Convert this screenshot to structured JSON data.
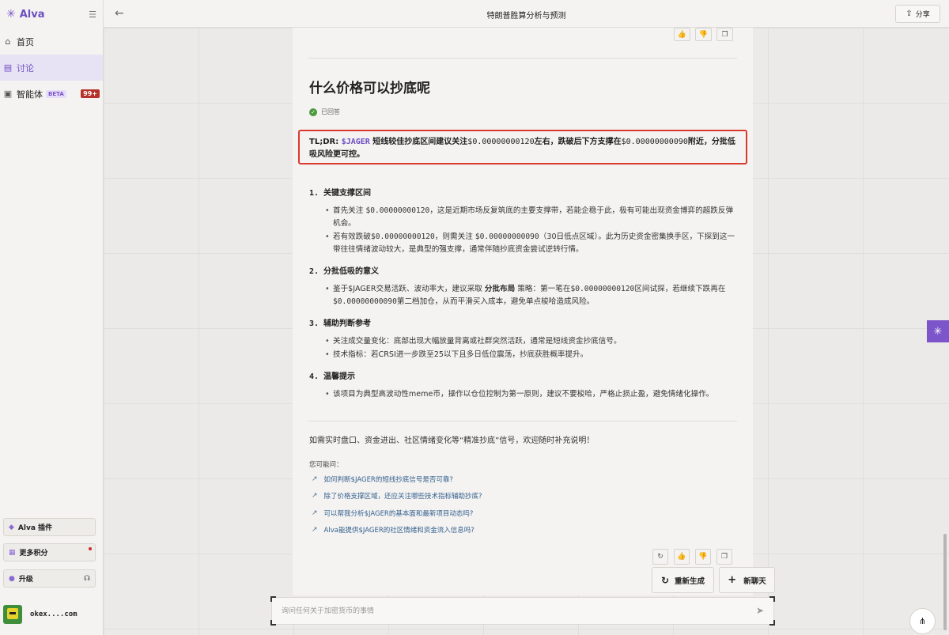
{
  "sidebar": {
    "brand": "Alva",
    "nav": [
      {
        "label": "首页"
      },
      {
        "label": "讨论"
      },
      {
        "label": "智能体",
        "badge": "BETA",
        "count": "99+"
      }
    ],
    "plugin_label": "Alva 插件",
    "points_label": "更多积分",
    "upgrade_label": "升级",
    "user_name": "okex....com"
  },
  "topbar": {
    "title": "特朗普胜算分析与预测",
    "share_label": "分享"
  },
  "answer": {
    "question": "什么价格可以抄底呢",
    "status": "已回答",
    "tldr": {
      "p1": "TL;DR: ",
      "ticker": "$JAGER",
      "p2": " 短线较佳抄底区间建议关注",
      "v1": "$0.00000000120",
      "p3": "左右，跌破后下方支撑在",
      "v2": "$0.00000000090",
      "p4": "附近，分批低吸风险更可控。"
    },
    "sections": [
      {
        "num": "1.",
        "title": "关键支撑区间",
        "bullets": [
          {
            "a": "首先关注 ",
            "m": "$0.00000000120",
            "b": "，这是近期市场反复筑底的主要支撑带，若能企稳于此，极有可能出现资金博弈的超跌反弹机会。"
          },
          {
            "a": "若有效跌破",
            "m": "$0.00000000120",
            "b": "，则需关注 ",
            "m2": "$0.00000000090",
            "c": "（30日低点区域）。此为历史资金密集换手区，下探到这一带往往情绪波动较大，是典型的强支撑，通常伴随抄底资金尝试逆转行情。"
          }
        ]
      },
      {
        "num": "2.",
        "title": "分批低吸的意义",
        "bullets": [
          {
            "a": "鉴于$JAGER交易活跃、波动率大，建议采取 ",
            "bold": "分批布局",
            "b": " 策略：第一笔在",
            "m": "$0.00000000120",
            "c": "区间试探，若继续下跌再在",
            "m2": "$0.00000000090",
            "d": "第二档加仓，从而平滑买入成本，避免单点梭哈造成风险。"
          }
        ]
      },
      {
        "num": "3.",
        "title": "辅助判断参考",
        "bullets": [
          {
            "a": "关注成交量变化：底部出现大幅放量背离或社群突然活跃，通常是短线资金抄底信号。"
          },
          {
            "a": "技术指标：若CRSI进一步跌至25以下且多日低位震荡，抄底获胜概率提升。"
          }
        ]
      },
      {
        "num": "4.",
        "title": "温馨提示",
        "bullets": [
          {
            "a": "该项目为典型高波动性meme币，操作以仓位控制为第一原则，建议不要梭哈，严格止损止盈，避免情绪化操作。"
          }
        ]
      }
    ],
    "closing": "如需实时盘口、资金进出、社区情绪变化等“精准抄底”信号，欢迎随时补充说明！",
    "maybe_label": "您可能问：",
    "suggestions": [
      "如何判断$JAGER的短线抄底信号是否可靠?",
      "除了价格支撑区域，还应关注哪些技术指标辅助抄底?",
      "可以帮我分析$JAGER的基本面和最新项目动态吗?",
      "Alva能提供$JAGER的社区情绪和资金流入信息吗?"
    ]
  },
  "actions": {
    "regenerate_label": "重新生成",
    "new_chat_label": "新聊天"
  },
  "composer": {
    "placeholder": "询问任何关于加密货币的事情"
  }
}
